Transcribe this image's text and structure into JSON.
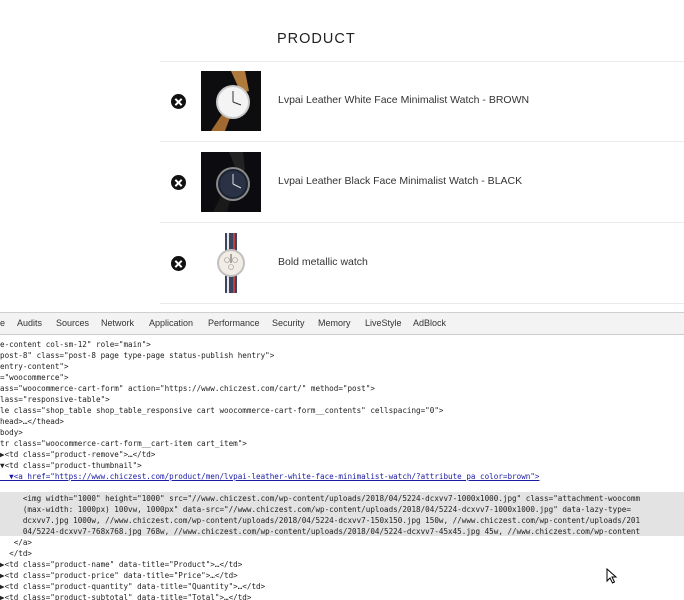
{
  "cart": {
    "header": "PRODUCT",
    "items": [
      {
        "name": "Lvpai Leather White Face Minimalist Watch - BROWN"
      },
      {
        "name": "Lvpai Leather Black Face Minimalist Watch - BLACK"
      },
      {
        "name": "Bold metallic watch"
      }
    ]
  },
  "devtools": {
    "tabs": [
      "e",
      "Audits",
      "Sources",
      "Network",
      "Application",
      "Performance",
      "Security",
      "Memory",
      "LiveStyle",
      "AdBlock"
    ],
    "lines": [
      "e-content col-sm-12\" role=\"main\">",
      "post-8\" class=\"post-8 page type-page status-publish hentry\">",
      "entry-content\">",
      "=\"woocommerce\">",
      "ass=\"woocommerce-cart-form\" action=\"https://www.chiczest.com/cart/\" method=\"post\">",
      "lass=\"responsive-table\">",
      "le class=\"shop_table shop_table_responsive cart woocommerce-cart-form__contents\" cellspacing=\"0\">",
      "head>…</thead>",
      "body>",
      "tr class=\"woocommerce-cart-form__cart-item cart_item\">",
      "▶<td class=\"product-remove\">…</td>",
      "▼<td class=\"product-thumbnail\">",
      "  ▼<a href=\"https://www.chiczest.com/product/men/lvpai-leather-white-face-minimalist-watch/?attribute_pa_color=brown\">",
      "     <img width=\"1000\" height=\"1000\" src=\"//www.chiczest.com/wp-content/uploads/2018/04/5224-dcxvv7-1000x1000.jpg\" class=\"attachment-woocomm",
      "     (max-width: 1000px) 100vw, 1000px\" data-src=\"//www.chiczest.com/wp-content/uploads/2018/04/5224-dcxvv7-1000x1000.jpg\" data-lazy-type=",
      "     dcxvv7.jpg 1000w, //www.chiczest.com/wp-content/uploads/2018/04/5224-dcxvv7-150x150.jpg 150w, //www.chiczest.com/wp-content/uploads/201",
      "     04/5224-dcxvv7-768x768.jpg 768w, //www.chiczest.com/wp-content/uploads/2018/04/5224-dcxvv7-45x45.jpg 45w, //www.chiczest.com/wp-content",
      "   </a>",
      "  </td>",
      "▶<td class=\"product-name\" data-title=\"Product\">…</td>",
      "▶<td class=\"product-price\" data-title=\"Price\">…</td>",
      "▶<td class=\"product-quantity\" data-title=\"Quantity\">…</td>",
      "▶<td class=\"product-subtotal\" data-title=\"Total\">…</td>"
    ]
  }
}
